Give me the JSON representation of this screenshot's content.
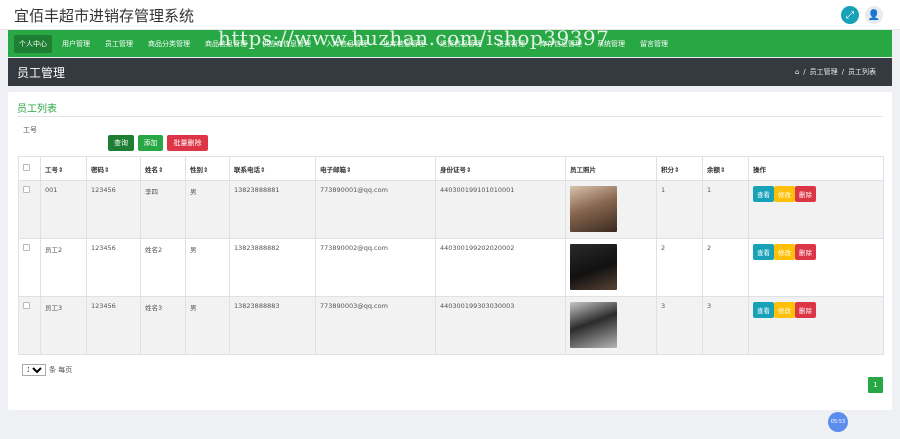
{
  "app": {
    "title": "宜佰丰超市进销存管理系统"
  },
  "topbar": {
    "expand_icon": "expand-icon",
    "user_icon": "user-icon"
  },
  "nav": {
    "items": [
      {
        "label": "个人中心",
        "active": true
      },
      {
        "label": "用户管理"
      },
      {
        "label": "员工管理"
      },
      {
        "label": "商品分类管理"
      },
      {
        "label": "商品信息管理"
      },
      {
        "label": "供应商信息管理"
      },
      {
        "label": "入库信息管理"
      },
      {
        "label": "出库信息管理"
      },
      {
        "label": "退货信息管理"
      },
      {
        "label": "进货管理"
      },
      {
        "label": "库存信息管理"
      },
      {
        "label": "系统管理"
      },
      {
        "label": "留言管理"
      }
    ]
  },
  "watermark": "https://www.huzhan.com/ishop39397",
  "page_header": {
    "title": "员工管理",
    "breadcrumb": [
      "员工管理",
      "员工列表"
    ]
  },
  "panel": {
    "title": "员工列表"
  },
  "search": {
    "label": "工号",
    "placeholder": "",
    "search_button": "查询",
    "add_button": "添加",
    "batch_delete_button": "批量删除"
  },
  "table": {
    "columns": [
      "工号",
      "密码",
      "姓名",
      "性别",
      "联系电话",
      "电子邮箱",
      "身份证号",
      "员工照片",
      "积分",
      "余额",
      "操作"
    ],
    "rows": [
      {
        "id": "001",
        "password": "123456",
        "name": "李四",
        "gender": "男",
        "phone": "13823888881",
        "email": "773890001@qq.com",
        "idcard": "440300199101010001",
        "points": "1",
        "balance": "1"
      },
      {
        "id": "员工2",
        "password": "123456",
        "name": "姓名2",
        "gender": "男",
        "phone": "13823888882",
        "email": "773890002@qq.com",
        "idcard": "440300199202020002",
        "points": "2",
        "balance": "2"
      },
      {
        "id": "员工3",
        "password": "123456",
        "name": "姓名3",
        "gender": "男",
        "phone": "13823888883",
        "email": "773890003@qq.com",
        "idcard": "440300199303030003",
        "points": "3",
        "balance": "3"
      }
    ],
    "actions": {
      "view": "查看",
      "edit": "修改",
      "delete": "删除"
    }
  },
  "pager": {
    "page_size": "10",
    "per_page_label": "条 每页",
    "current_page": "1"
  },
  "badge": "05:53",
  "colors": {
    "primary": "#28a745",
    "dark": "#343a40",
    "info": "#17a2b8",
    "warning": "#ffc107",
    "danger": "#dc3545"
  }
}
